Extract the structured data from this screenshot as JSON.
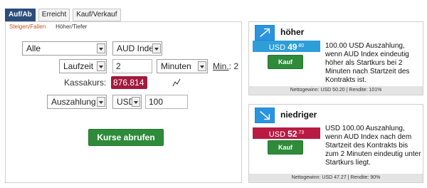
{
  "tabs": [
    {
      "label": "Auf/Ab",
      "active": true
    },
    {
      "label": "Erreicht",
      "active": false
    },
    {
      "label": "Kauf/Verkauf",
      "active": false
    }
  ],
  "subtabs": [
    {
      "label": "Steigen/Fallen",
      "active": true
    },
    {
      "label": "Höher/Tiefer",
      "active": false
    }
  ],
  "form": {
    "filter": "Alle",
    "underlying": "AUD Index",
    "duration_type": "Laufzeit",
    "duration_value": "2",
    "duration_unit": "Minuten",
    "min_label": "Min.",
    "min_value": ": 2",
    "spot_label": "Kassakurs:",
    "spot_value": "876.814",
    "payout_type": "Auszahlung",
    "currency": "USD",
    "amount": "100",
    "submit_label": "Kurse abrufen"
  },
  "cards": {
    "higher": {
      "title": "höher",
      "currency": "USD",
      "price_int": "49",
      "price_frac": ".80",
      "buy_label": "Kauf",
      "description": "100.00 USD Auszahlung, wenn AUD Index eindeutig höher als Startkurs bei 2 Minuten nach Startzeit des Kontrakts ist.",
      "footer": "Nettogewinn: USD 50.20 | Rendite: 101%",
      "price_color": "#2d9ed8"
    },
    "lower": {
      "title": "niedriger",
      "currency": "USD",
      "price_int": "52",
      "price_frac": ".73",
      "buy_label": "Kauf",
      "description": "USD 100.00 Auszahlung, wenn AUD Index nach dem Startzeit des Kontrakts bis zum 2 Minuten eindeutig unter Startkurs liegt.",
      "footer": "Nettogewinn: USD 47.27 | Rendite: 90%",
      "price_color": "#b81a43"
    }
  },
  "colors": {
    "tab_active": "#2b4d7a",
    "button_green": "#2e8b3a",
    "spot_bg": "#a31a3e",
    "subtab_active": "#c9531e",
    "icon_blue": "#2a94e0"
  },
  "icons": {
    "higher": "arrow-up-right-icon",
    "lower": "arrow-down-right-icon",
    "spot_trend": "sparkline-icon"
  }
}
